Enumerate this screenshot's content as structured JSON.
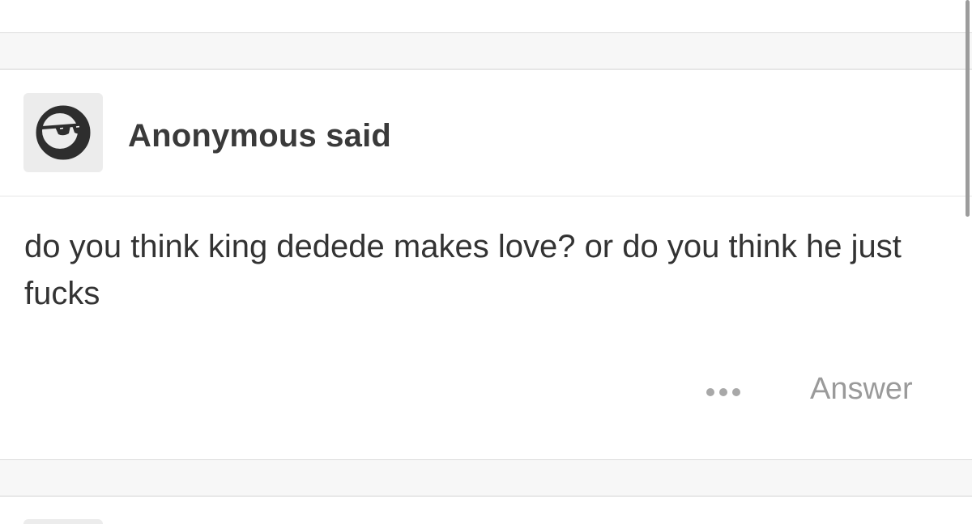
{
  "post": {
    "asker_label": "Anonymous said",
    "avatar_icon": "anonymous-sunglasses-icon",
    "question_text": "do you think king dedede makes love? or do you think he just fucks"
  },
  "actions": {
    "more_icon": "ellipsis-icon",
    "answer_label": "Answer"
  },
  "colors": {
    "page_background": "#ffffff",
    "separator_band": "#f7f7f7",
    "avatar_tile": "#ececec",
    "asker_text": "#3a3a3a",
    "question_text": "#333333",
    "action_text": "#9a9a9a"
  }
}
